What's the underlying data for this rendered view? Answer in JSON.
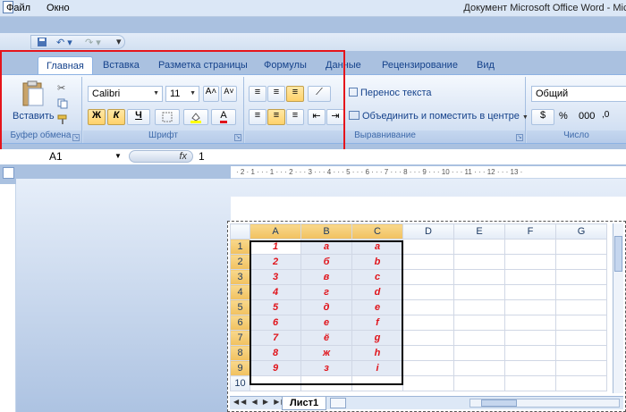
{
  "app": {
    "title": "Документ Microsoft Office Word - Microsoft",
    "menu": [
      "Файл",
      "Окно"
    ]
  },
  "qat": {
    "undo": "↶ ▾",
    "redo": "↷ ▾",
    "customize": "▾"
  },
  "tabs": [
    "Главная",
    "Вставка",
    "Разметка страницы",
    "Формулы",
    "Данные",
    "Рецензирование",
    "Вид"
  ],
  "ribbon": {
    "clipboard": {
      "paste": "Вставить",
      "label": "Буфер обмена"
    },
    "font": {
      "name": "Calibri",
      "size": "11",
      "grow": "A˄",
      "shrink": "A˅",
      "bold": "Ж",
      "italic": "К",
      "underline": "Ч",
      "font_color": "A",
      "label": "Шрифт"
    },
    "alignment": {
      "wrap": "Перенос текста",
      "merge": "Объединить и поместить в центре",
      "label": "Выравнивание"
    },
    "number": {
      "format": "Общий",
      "percent": "%",
      "thousands": "000",
      "label": "Число"
    }
  },
  "formula_bar": {
    "name_box": "A1",
    "fx": "fx",
    "value": "1"
  },
  "ruler": "· 2 · 1 · · · 1 · · · 2 · · · 3 · · · 4 · · · 5 · · · 6 · · · 7 · · · 8 · · · 9 · · · 10 · · · 11 · · · 12 · · · 13 ·",
  "sheet": {
    "columns": [
      "A",
      "B",
      "C",
      "D",
      "E",
      "F",
      "G"
    ],
    "rows": [
      {
        "n": "1",
        "a": "1",
        "b": "а",
        "c": "a"
      },
      {
        "n": "2",
        "a": "2",
        "b": "б",
        "c": "b"
      },
      {
        "n": "3",
        "a": "3",
        "b": "в",
        "c": "c"
      },
      {
        "n": "4",
        "a": "4",
        "b": "г",
        "c": "d"
      },
      {
        "n": "5",
        "a": "5",
        "b": "д",
        "c": "e"
      },
      {
        "n": "6",
        "a": "6",
        "b": "е",
        "c": "f"
      },
      {
        "n": "7",
        "a": "7",
        "b": "ё",
        "c": "g"
      },
      {
        "n": "8",
        "a": "8",
        "b": "ж",
        "c": "h"
      },
      {
        "n": "9",
        "a": "9",
        "b": "з",
        "c": "i"
      },
      {
        "n": "10",
        "a": "",
        "b": "",
        "c": ""
      }
    ],
    "tab": "Лист1"
  }
}
